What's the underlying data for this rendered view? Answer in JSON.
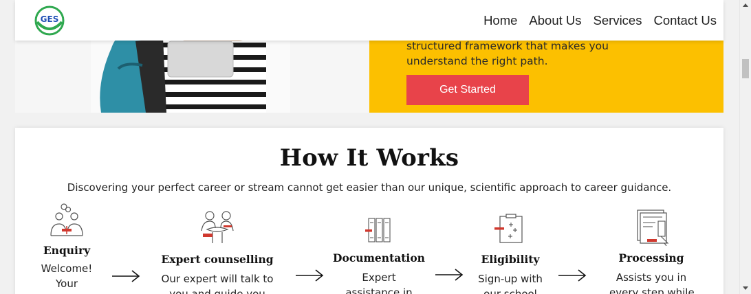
{
  "header": {
    "logo_text": "GES",
    "nav": [
      "Home",
      "About Us",
      "Services",
      "Contact Us"
    ]
  },
  "hero": {
    "text_lines": [
      "structured framework that makes you",
      "understand the right path."
    ],
    "cta_label": "Get Started",
    "panel_color": "#fcc000",
    "cta_color": "#e8434a"
  },
  "how": {
    "title": "How It Works",
    "subtitle": "Discovering your perfect career or stream cannot get easier than our unique, scientific approach to career guidance.",
    "steps": [
      {
        "title": "Enquiry",
        "desc": [
          "Welcome!",
          "Your"
        ],
        "icon": "people-chat-icon"
      },
      {
        "title": "Expert counselling",
        "desc": [
          "Our expert will talk to",
          "you and guide you"
        ],
        "icon": "counselling-icon"
      },
      {
        "title": "Documentation",
        "desc": [
          "Expert",
          "assistance in"
        ],
        "icon": "documents-icon"
      },
      {
        "title": "Eligibility",
        "desc": [
          "Sign-up with",
          "our school"
        ],
        "icon": "checklist-icon"
      },
      {
        "title": "Processing",
        "desc": [
          "Assists you in",
          "every step while"
        ],
        "icon": "processing-icon"
      }
    ],
    "accent_color": "#d0382e"
  }
}
